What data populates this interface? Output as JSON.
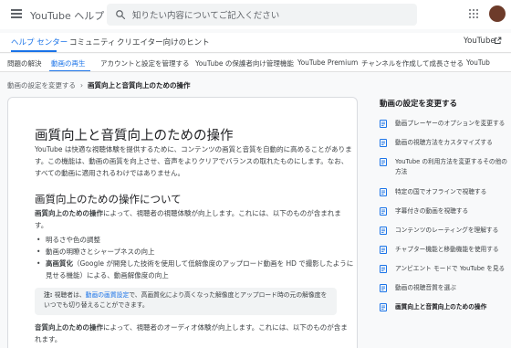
{
  "header": {
    "brand": "YouTube ヘルプ",
    "search_placeholder": "知りたい内容についてご記入ください"
  },
  "nav": {
    "tabs": [
      {
        "label": "ヘルプ センター",
        "active": true
      },
      {
        "label": "コミュニティ",
        "active": false
      },
      {
        "label": "クリエイター向けのヒント",
        "active": false
      }
    ],
    "youtube_link": "YouTube"
  },
  "subnav": {
    "tabs": [
      {
        "label": "問題の解決",
        "active": false
      },
      {
        "label": "動画の再生",
        "active": true
      },
      {
        "label": "アカウントと設定を管理する",
        "active": false
      },
      {
        "label": "YouTube の保護者向け管理機能",
        "active": false
      },
      {
        "label": "YouTube Premium",
        "active": false
      },
      {
        "label": "チャンネルを作成して成長させる",
        "active": false
      },
      {
        "label": "YouTub",
        "active": false
      }
    ]
  },
  "breadcrumb": {
    "parent": "動画の設定を変更する",
    "current": "画質向上と音質向上のための操作"
  },
  "article": {
    "title": "画質向上と音質向上のための操作",
    "intro": "YouTube は快適な視聴体験を提供するために、コンテンツの画質と音質を自動的に高めることがあります。この機能は、動画の画質を向上させ、音声をよりクリアでバランスの取れたものにします。なお、すべての動画に適用されるわけではありません。",
    "h2": "画質向上のための操作について",
    "video_lead": "画質向上のための操作",
    "video_rest": "によって、視聴者の視聴体験が向上します。これには、以下のものが含まれます。",
    "bullets": [
      {
        "strong": "",
        "text": "明るさや色の調整"
      },
      {
        "strong": "",
        "text": "動画の明瞭さとシャープネスの向上"
      },
      {
        "strong": "高画質化",
        "text": "（Google が開発した技術を使用して低解像度のアップロード動画を HD で撮影したように見せる機能）による、動画解像度の向上"
      }
    ],
    "note": {
      "label": "注:",
      "pre": " 視聴者は、",
      "link": "動画の画質設定",
      "post": "で、高画質化により高くなった解像度とアップロード時の元の解像度をいつでも切り替えることができます。"
    },
    "audio_lead": "音質向上のための操作",
    "audio_rest": "によって、視聴者のオーディオ体験が向上します。これには、以下のものが含まれます。"
  },
  "sidebar": {
    "title": "動画の設定を変更する",
    "items": [
      {
        "label": "動画プレーヤーのオプションを変更する",
        "current": false
      },
      {
        "label": "動画の視聴方法をカスタマイズする",
        "current": false
      },
      {
        "label": "YouTube の利用方法を変更するその他の方法",
        "current": false
      },
      {
        "label": "特定の国でオフラインで視聴する",
        "current": false
      },
      {
        "label": "字幕付きの動画を視聴する",
        "current": false
      },
      {
        "label": "コンテンツのレーティングを理解する",
        "current": false
      },
      {
        "label": "チャプター機能と移動機能を使用する",
        "current": false
      },
      {
        "label": "アンビエント モードで YouTube を見る",
        "current": false
      },
      {
        "label": "動画の視聴音質を選ぶ",
        "current": false
      },
      {
        "label": "画質向上と音質向上のための操作",
        "current": true
      }
    ]
  },
  "colors": {
    "accent": "#1a73e8",
    "avatar": "#6d3b2a"
  }
}
